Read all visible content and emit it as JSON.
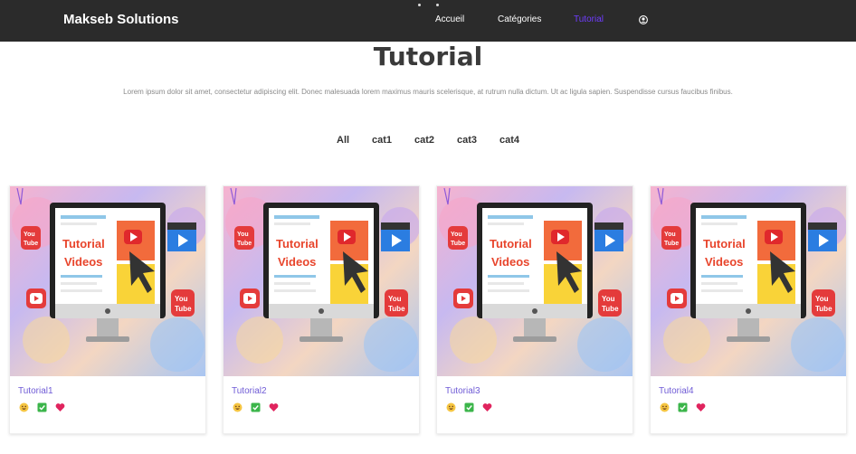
{
  "navbar": {
    "brand": "Makseb Solutions",
    "links": [
      {
        "label": "Accueil",
        "active": false
      },
      {
        "label": "Catégories",
        "active": false
      },
      {
        "label": "Tutorial",
        "active": true
      }
    ],
    "user_icon": "user-circle-icon",
    "active_color": "#6f3cff",
    "background": "#2b2b2b"
  },
  "main": {
    "title": "Tutorial",
    "intro": "Lorem ipsum dolor sit amet, consectetur adipiscing elit. Donec malesuada lorem maximus mauris scelerisque, at rutrum nulla dictum. Ut ac ligula sapien. Suspendisse cursus faucibus finibus.",
    "filters": [
      "All",
      "cat1",
      "cat2",
      "cat3",
      "cat4"
    ]
  },
  "cards": [
    {
      "title": "Tutorial1",
      "thumbnail_text": [
        "Tutorial",
        "Videos"
      ],
      "reactions": [
        "smiley-icon",
        "check-box-icon",
        "heart-icon"
      ]
    },
    {
      "title": "Tutorial2",
      "thumbnail_text": [
        "Tutorial",
        "Videos"
      ],
      "reactions": [
        "smiley-icon",
        "check-box-icon",
        "heart-icon"
      ]
    },
    {
      "title": "Tutorial3",
      "thumbnail_text": [
        "Tutorial",
        "Videos"
      ],
      "reactions": [
        "smiley-icon",
        "check-box-icon",
        "heart-icon"
      ]
    },
    {
      "title": "Tutorial4",
      "thumbnail_text": [
        "Tutorial",
        "Videos"
      ],
      "reactions": [
        "smiley-icon",
        "check-box-icon",
        "heart-icon"
      ]
    }
  ],
  "thumbnail_badge": [
    "You",
    "Tube"
  ],
  "colors": {
    "card_title": "#6f5bd6",
    "thumb_text": "#e8452c",
    "heart": "#e0245e",
    "check": "#3bb54a"
  }
}
